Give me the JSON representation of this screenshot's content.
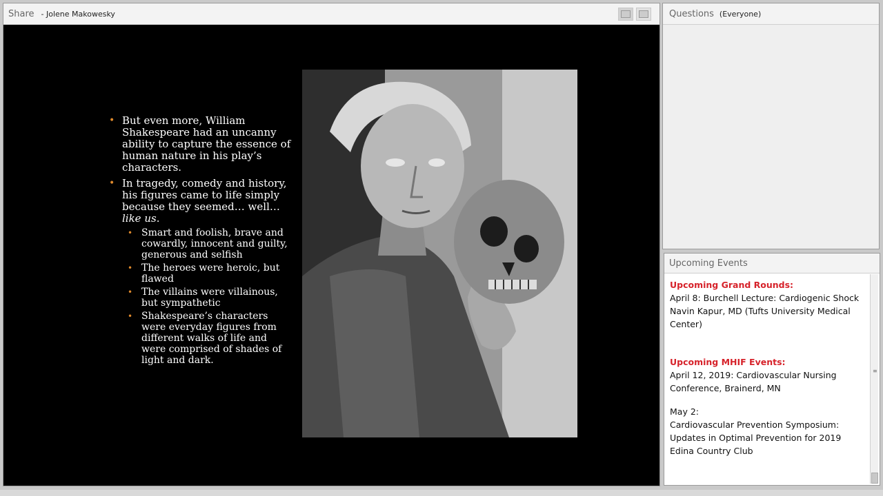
{
  "share_pod": {
    "title": "Share",
    "presenter": "- Jolene Makowesky"
  },
  "slide": {
    "bullets": [
      {
        "text": "But even more, William Shakespeare had an uncanny ability to capture the essence of human nature in his play’s characters."
      },
      {
        "text_pre": "In tragedy, comedy and history, his figures came to life simply because they seemed… well… ",
        "text_em": "like us",
        "text_post": "."
      }
    ],
    "sub_bullets": [
      "Smart and foolish, brave and cowardly, innocent and guilty, generous and selfish",
      "The heroes were heroic, but flawed",
      "The villains were villainous, but sympathetic",
      "Shakespeare’s characters were everyday figures from different walks of life and were comprised of shades of light and dark."
    ],
    "bullet_color": "#e08a2c"
  },
  "questions_pod": {
    "title": "Questions",
    "scope": "(Everyone)"
  },
  "events_pod": {
    "title": "Upcoming Events",
    "grand_rounds_heading": "Upcoming Grand Rounds:",
    "grand_rounds_line1": "April 8: Burchell Lecture: Cardiogenic Shock",
    "grand_rounds_line2": "Navin Kapur, MD (Tufts University Medical Center)",
    "mhif_heading": "Upcoming MHIF Events:",
    "mhif_line1": "April 12, 2019: Cardiovascular Nursing Conference, Brainerd, MN",
    "mhif_date2": "May 2:",
    "mhif_line2": "Cardiovascular Prevention Symposium: Updates in Optimal Prevention for 2019",
    "mhif_line3": "Edina Country Club",
    "heading_color": "#d6222a"
  }
}
